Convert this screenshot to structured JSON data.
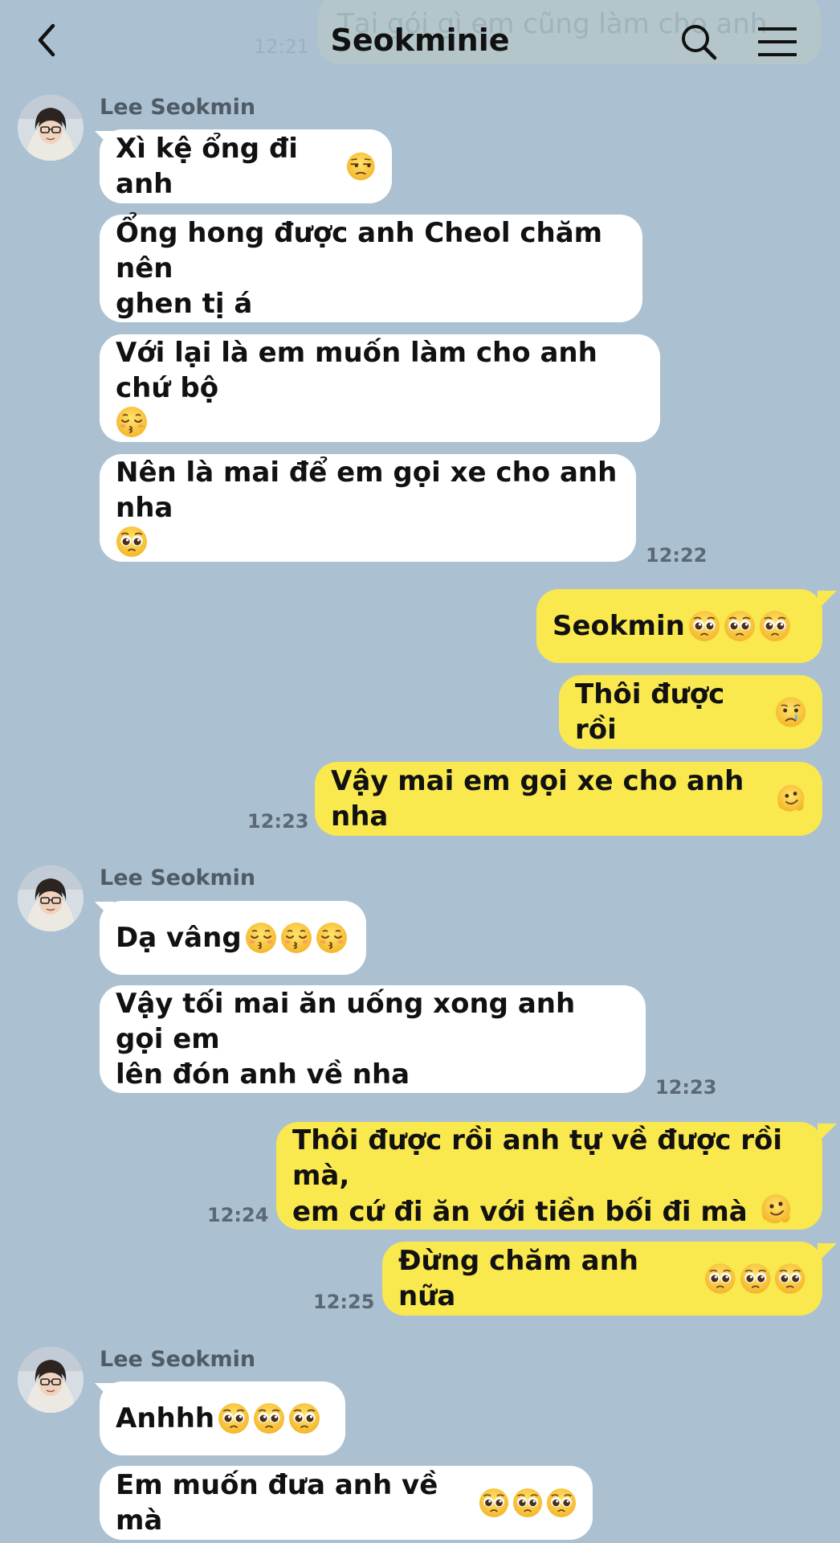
{
  "header": {
    "title": "Seokminie",
    "back_icon": "chevron-left-icon",
    "search_icon": "search-icon",
    "menu_icon": "hamburger-menu-icon",
    "ghost_message": "Tại gói gì em cũng làm cho anh",
    "ghost_time": "12:21"
  },
  "colors": {
    "background": "#abc1d1",
    "incoming_bubble": "#ffffff",
    "outgoing_bubble": "#fae84f"
  },
  "groups": [
    {
      "sender": "Lee Seokmin",
      "messages": [
        {
          "text": "Xì kệ ổng đi anh",
          "emoji": "unamused-face"
        },
        {
          "line1": "Ổng hong được anh Cheol chăm nên",
          "line2": "ghen tị á"
        },
        {
          "line1": "Với lại là em muốn làm cho anh chứ bộ",
          "emoji": "kissing-face"
        },
        {
          "line1": "Nên là mai để em gọi xe cho anh nha",
          "emoji": "pleading-face"
        }
      ],
      "time": "12:22"
    },
    {
      "outgoing": [
        {
          "text": "Seokmin",
          "emoji": "pleading-face x3"
        },
        {
          "text": "Thôi được rồi",
          "emoji": "crying-face"
        },
        {
          "text": "Vậy mai em gọi xe cho anh nha",
          "emoji": "melting-face"
        }
      ],
      "time": "12:23"
    },
    {
      "sender": "Lee Seokmin",
      "messages": [
        {
          "text": "Dạ vâng",
          "emoji": "kissing-face x3"
        },
        {
          "line1": "Vậy tối mai ăn uống xong anh gọi em",
          "line2": "lên đón anh về nha"
        }
      ],
      "time": "12:23"
    },
    {
      "outgoing": [
        {
          "line1": "Thôi được rồi anh tự về được rồi mà,",
          "line2": "em cứ đi ăn với tiền bối đi mà",
          "emoji": "melting-face"
        }
      ],
      "time": "12:24"
    },
    {
      "outgoing": [
        {
          "text": "Đừng chăm anh nữa",
          "emoji": "pleading-face x3"
        }
      ],
      "time": "12:25"
    },
    {
      "sender": "Lee Seokmin",
      "messages": [
        {
          "text": "Anhhh",
          "emoji": "pleading-face x3"
        },
        {
          "text": "Em muốn đưa anh về mà",
          "emoji": "pleading-face x3"
        }
      ]
    }
  ]
}
